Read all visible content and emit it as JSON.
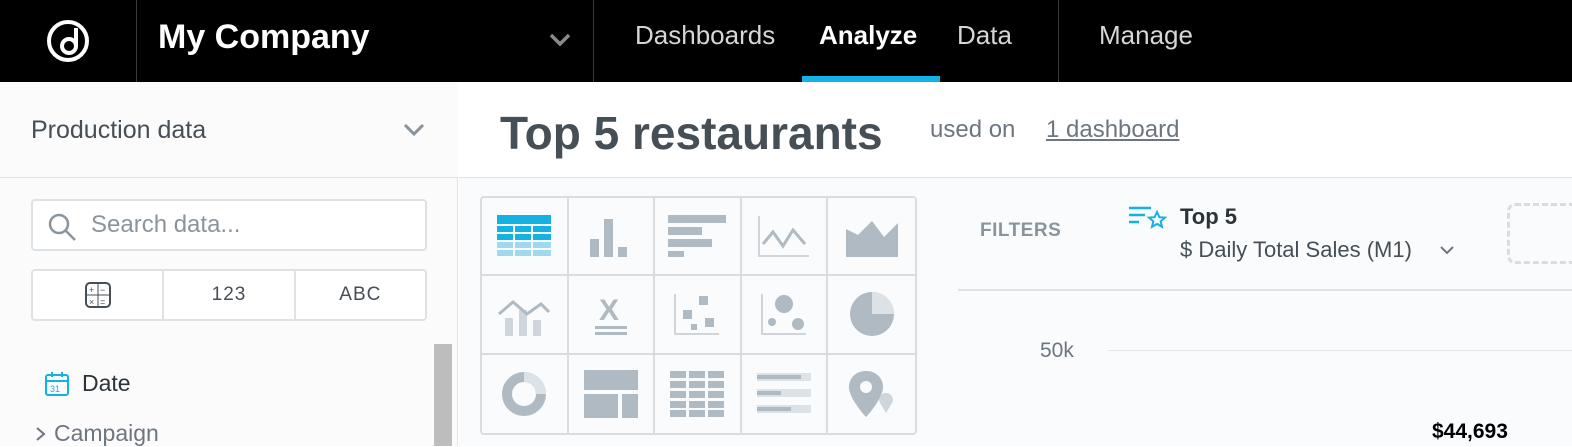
{
  "topbar": {
    "company": "My Company",
    "nav": [
      "Dashboards",
      "Analyze",
      "Data",
      "Manage"
    ],
    "active_nav": "Analyze",
    "accent": "#14b2e2"
  },
  "left": {
    "datasource": "Production data",
    "search_placeholder": "Search data...",
    "type_filters": [
      "123",
      "ABC"
    ],
    "catalog": {
      "date_label": "Date",
      "items": [
        "Campaign"
      ]
    }
  },
  "main": {
    "title": "Top 5 restaurants",
    "used_on": "used on",
    "used_on_link": "1 dashboard"
  },
  "filters": {
    "label": "FILTERS",
    "filter_title": "Top 5",
    "filter_sub": "$ Daily Total Sales (M1)"
  },
  "chart": {
    "y_tick": "50k",
    "data_label": "$44,693"
  },
  "viz_types": [
    "table-icon",
    "column-chart-icon",
    "bar-chart-icon",
    "line-chart-icon",
    "area-chart-icon",
    "combo-chart-icon",
    "headline-icon",
    "scatter-plot-icon",
    "bubble-chart-icon",
    "pie-chart-icon",
    "donut-chart-icon",
    "treemap-icon",
    "heatmap-icon",
    "bullet-chart-icon",
    "geo-chart-icon"
  ]
}
